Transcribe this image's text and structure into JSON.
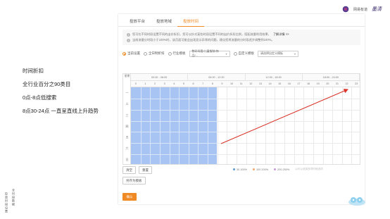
{
  "brand": {
    "logo_text": "网易有道",
    "signature": "墨清"
  },
  "side_text": {
    "a": "投放时段设置",
    "b": "全时段数据"
  },
  "notes": [
    "时间折扣",
    "全行业百分之90类目",
    "0点-8点低搜索",
    "8点30-24点 一直呈直线上升趋势"
  ],
  "tabs": [
    {
      "label": "投放平台",
      "active": false
    },
    {
      "label": "投放地域",
      "active": false
    },
    {
      "label": "投放时间",
      "active": true
    }
  ],
  "info": {
    "line1": "您可在不同时段设置不同的出价折扣，您可以针对某些时段设置不同的出价折扣比例，搭配流量利用效果，",
    "line1_link": "了解详情 >>",
    "line2": "当前流量分时段小于100%时，该页面可能会出现显示异常的问题，建议您将流量的分时段逐步调整到100%。"
  },
  "options": {
    "radio1": "当前设置",
    "radio2": "全日制折扣",
    "radio3": "行业模板",
    "select1": "数码母婴/儿童服装/饰品/...",
    "radio4": "自定义模板",
    "select2": "请选择自定义模板"
  },
  "grid": {
    "corner_label": "星期",
    "periods": [
      "00:00 - 06:00",
      "06:00 - 12:00",
      "12:00 - 18:00",
      "18:00 - 24:00"
    ],
    "hours": [
      "0",
      "1",
      "2",
      "3",
      "4",
      "5",
      "6",
      "7",
      "8",
      "9",
      "10",
      "11",
      "12",
      "13",
      "14",
      "15",
      "16",
      "17",
      "18",
      "19",
      "20",
      "21",
      "22",
      "23"
    ],
    "days": [
      "一",
      "二",
      "三",
      "四",
      "五",
      "六",
      "日"
    ],
    "highlight_hours": 9
  },
  "buttons": {
    "clear": "清空",
    "reset": "重置",
    "save_template": "另存为模板",
    "confirm": "确认"
  },
  "legend": [
    {
      "label": "30  100%",
      "color": "#5b9bd5"
    },
    {
      "label": "100  200%",
      "color": "#f4a66c"
    },
    {
      "label": "200  250%",
      "color": "#c99ad8"
    }
  ],
  "legend_note": "以可以选择多项时段选项",
  "colors": {
    "accent": "#f08a24",
    "cell": "#a8c4f2",
    "arrow": "#d9352b"
  }
}
